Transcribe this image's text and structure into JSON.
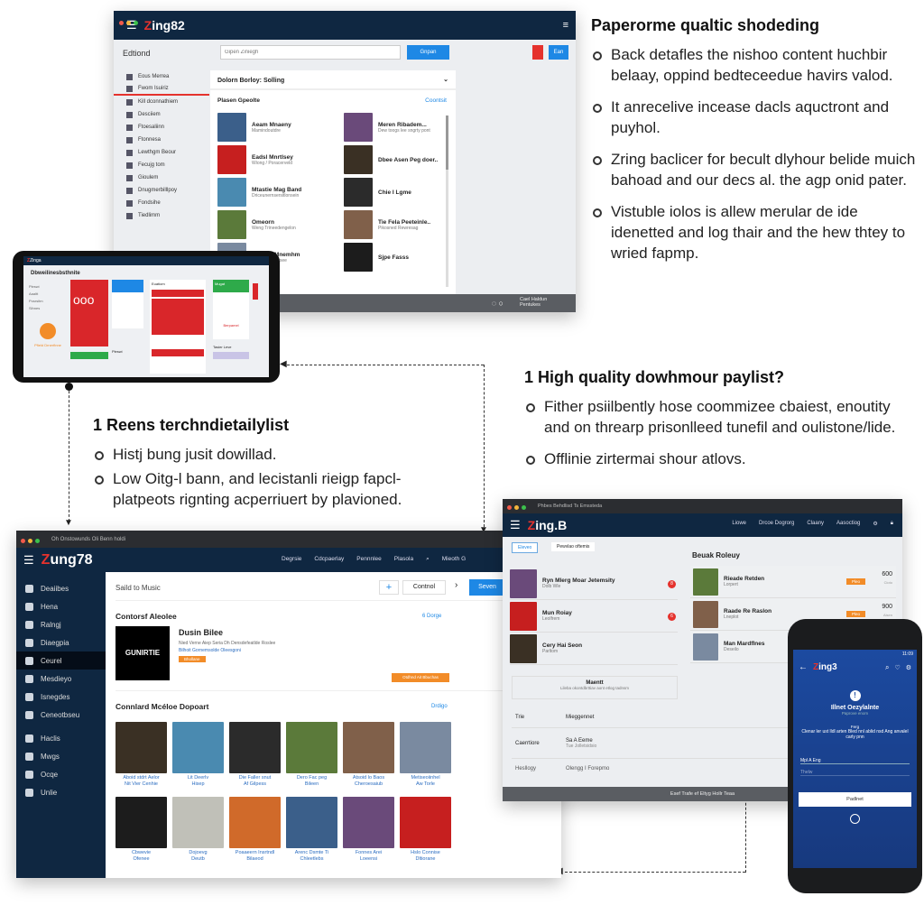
{
  "text_top_right": {
    "title": "Paperorme qualtic shodeding",
    "bullets": [
      "Back detafles the nishoo content huchbir belaay, oppind bedteceedue havirs valod.",
      "It anrecelive incease dacls aquctront and puyhol.",
      "Zring baclicer for becult dlyhour belide muich bahoad and our decs al. the agp onid pater.",
      "Vistuble iolos is allew merular de ide idenetted and log thair and the hew thtey to wried fapmp."
    ]
  },
  "text_mid_left": {
    "title": "1 Reens terchndietailylist",
    "bullets": [
      "Histj bung jusit dowillad.",
      "Low Oitg-l bann, and lecistanli rieigp fapcl-platpeots rignting acperriuert by plavioned."
    ]
  },
  "text_mid_right": {
    "title": "1 High quality dowhmour paylist?",
    "bullets": [
      "Fither psiilbently hose coommizee cbaiest, enoutity and on threarp prisonlleed tunefil and oulistone/lide.",
      "Offlinie zirtermai shour atlovs."
    ]
  },
  "colors": {
    "navy": "#0f2741",
    "red": "#e5322d",
    "blue": "#1e88e5",
    "orange": "#f28c28",
    "green": "#2eaa4a"
  },
  "win1": {
    "logo_a": "Z",
    "logo_b": "ing82",
    "page_title": "Edtiond",
    "search_placeholder": "Gipen Ziniegh",
    "search_button": "Gnpan",
    "action_button": "Ean",
    "sidebar": [
      "Eous Merrea",
      "Fwom Isuiriz",
      "Kill dconnathiem",
      "Desciiem",
      "Ftoesaliinn",
      "Ftonnesa",
      "Lewthgm Beour",
      "Fecujg tom",
      "Gioulem",
      "Dnugmerbilllpoy",
      "Fondsihe",
      "Tiedlimm"
    ],
    "panel_header": "Dolorn Borloy: Solling",
    "section_title": "Plasen Gpeolte",
    "section_link": "Coontsit",
    "items": [
      {
        "title": "Aeam Mnaeny",
        "sub": "Mamindoutdre"
      },
      {
        "title": "Meren Ribadem...",
        "sub": "Dew toogs lee sngrty pont"
      },
      {
        "title": "Eadsl Mnrtlsey",
        "sub": "Wiong / Poracerveld"
      },
      {
        "title": "Dbee Asen Peg doer..",
        "sub": ""
      },
      {
        "title": "Mtastie Mag Band",
        "sub": "Driceunernsersitlonsein"
      },
      {
        "title": "Chie I Lgme",
        "sub": ""
      },
      {
        "title": "Omeorn",
        "sub": "Weng Trineedengelon"
      },
      {
        "title": "Tie Fela Peeteinle..",
        "sub": "Pikosned Rewresag"
      },
      {
        "title": "Eonliell Mnemhm",
        "sub": "Pagewr Endlitsee"
      },
      {
        "title": "Sjpe Fasss",
        "sub": ""
      }
    ],
    "footer": "Cael Haldun Pentukes"
  },
  "tablet": {
    "logo": "Zinga",
    "title": "Dbweilinesbsthnite",
    "big_number": "ooo",
    "tabs": [
      "Pleswi",
      "Aaaltt",
      "Posrsitm",
      "Sihnes"
    ],
    "card_head": "Euatiom",
    "green_head": "Mugat",
    "bottom_label": "Tasier Leve",
    "orange_caption": "Pfield Drnerfinne",
    "red_caption": "Berpamel"
  },
  "win2": {
    "window_title": "Oh Onstowunds Oli Benn holdi",
    "logo_a": "Z",
    "logo_b": "ung78",
    "nav": [
      "Degrsie",
      "Cdcpaerlay",
      "Pennnlee",
      "Plasola",
      "Mieoth G"
    ],
    "sidebar": [
      "Deaiibes",
      "Hena",
      "Ralngj",
      "Diaegpia",
      "Ceurel",
      "Mesdieyo",
      "Isnegdes",
      "Ceneotbseu",
      "Haclis",
      "Mwgs",
      "Ocqe",
      "Unlie"
    ],
    "breadcrumb": "Saild to Music",
    "add_label": "+",
    "control_button": "Contnol",
    "primary_button": "Seven",
    "section1": "Contorsf Aleolee",
    "section1_link": "6 Dorge",
    "featured_title": "Dusin Bilee",
    "featured_art_text": "GUNIRTIE",
    "featured_desc": "Nied Verne Aiep Seria Dh Densdefeatlde Roslee",
    "featured_link": "Bilhoit Gornemsolde Oleesgoni",
    "featured_badge": "Bhollane",
    "featured_action": "Otdhnd Ait Bbuchas",
    "section2": "Connlard Mcéloe Dopoart",
    "section2_link": "Drdigo",
    "grid": [
      {
        "t": "Aboid stdrt Aelor",
        "s": "Nit Vier Cenhie"
      },
      {
        "t": "Lit Deerlv",
        "s": "Hisep"
      },
      {
        "t": "Die Faller snut",
        "s": "Af Gilpess"
      },
      {
        "t": "Dero Fac peg",
        "s": "Bileen"
      },
      {
        "t": "Atsoid lo Baos",
        "s": "Cheroesaiub"
      },
      {
        "t": "Metiseoiinhel",
        "s": "Aw Torle"
      },
      {
        "t": "Cbwevie",
        "s": "Ofenee"
      },
      {
        "t": "Dojoevg",
        "s": "Deutb"
      },
      {
        "t": "Poaaeern Insrtndl",
        "s": "Bilaeod"
      },
      {
        "t": "Arenc Dsmte Ti",
        "s": "Chleetlebs"
      },
      {
        "t": "Fonnes Arei",
        "s": "Loeensi"
      },
      {
        "t": "Hslo Connise",
        "s": "Dltiorane"
      }
    ]
  },
  "win3": {
    "window_title": "Phbes Behdlisd Ts Emssteda",
    "logo_a": "Z",
    "logo_b": "ing.B",
    "nav": [
      "Liowe",
      "Drcoe Dogrorg",
      "Claany",
      "Aasoctiog"
    ],
    "chip1": "Eleveo",
    "chip2": "Pewvlao oftemis",
    "list": [
      {
        "t": "Ryn Mlerg Moar Jetemsity",
        "s": "Dolb Wle",
        "badge": "8"
      },
      {
        "t": "Mun Roiay",
        "s": "Leolfrem",
        "badge": "6"
      },
      {
        "t": "Cery Hai Seon",
        "s": "Parltom",
        "badge": ""
      }
    ],
    "box_title": "Maentt",
    "box_sub": "Lileba okontdbrttiav aont etlog tadnsm",
    "right_title": "Beuak Roleuy",
    "right_list": [
      {
        "t": "Rieade Retden",
        "s": "Lorpert",
        "tag": "Pleo",
        "num": "600",
        "unit": "Cioto"
      },
      {
        "t": "Raade Re Raslon",
        "s": "Lneplot",
        "tag": "Pleo",
        "num": "900",
        "unit": "Aisen"
      },
      {
        "t": "Man Mardflnes",
        "s": "Deseilo",
        "tag": "",
        "num": "",
        "unit": ""
      }
    ],
    "table": [
      {
        "k": "Trie",
        "v": "Mieggennet"
      },
      {
        "k": "Caerrtiore",
        "v": "Sa A Eeme"
      },
      {
        "k": "Hesllogy",
        "v": "Olengg I Forepmo"
      }
    ],
    "table_sub": "Tue Jolletsidsio",
    "footer": "Esef Trafe ef Eltyg Hollr Teaa"
  },
  "phone": {
    "logo_a": "Z",
    "logo_b": "ing3",
    "status": "11:09",
    "title": "Illnet Oezylalnte",
    "subtitle": "Paprove enom",
    "label": "Ferg",
    "body": "Clenar ler ust lldl arten Bled nnl ablid nsd Ang anvalel carly pnn",
    "input_label": "Mpl A Eng",
    "input_value": "Thelw",
    "button": "Padlnet"
  }
}
